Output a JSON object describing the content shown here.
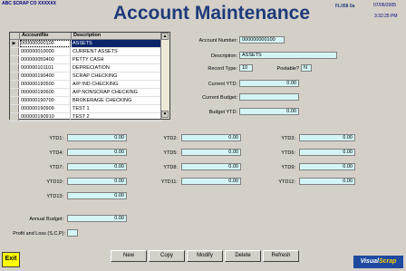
{
  "header": {
    "company": "ABC SCRAP CO XXXXXX",
    "title": "Account Maintenance",
    "form_code": "FL058 0a",
    "date": "07/06/2005",
    "time": "3:32:25 PM"
  },
  "grid": {
    "columns": [
      "AccountNo",
      "Description"
    ],
    "rows": [
      {
        "account": "000000000100",
        "description": "ASSETS"
      },
      {
        "account": "000000010000",
        "description": "CURRENT ASSETS"
      },
      {
        "account": "000000050400",
        "description": "PETTY CASH"
      },
      {
        "account": "000000101101",
        "description": "DEPRECIATION"
      },
      {
        "account": "000000190400",
        "description": "SCRAP CHECKING"
      },
      {
        "account": "000000190500",
        "description": "A/P IND CHECKING"
      },
      {
        "account": "000000190600",
        "description": "A/P NONSCRAP CHECKING"
      },
      {
        "account": "000000190700",
        "description": "BROKERAGE CHECKING"
      },
      {
        "account": "000000190909",
        "description": "TEST 1"
      },
      {
        "account": "000000190910",
        "description": "TEST 2"
      }
    ],
    "selected_marker": "▶"
  },
  "detail": {
    "account_number_label": "Account Number:",
    "account_number": "000000000100",
    "description_label": "Description:",
    "description": "ASSETS",
    "record_type_label": "Record Type:",
    "record_type": "10",
    "postable_label": "Postable?",
    "postable": "N",
    "current_ytd_label": "Current YTD:",
    "current_ytd": "0.00",
    "current_budget_label": "Current Budget:",
    "current_budget": "",
    "budget_ytd_label": "Budget YTD:",
    "budget_ytd": "0.00"
  },
  "ytd": [
    {
      "label": "YTD1:",
      "value": "0.00"
    },
    {
      "label": "YTD2:",
      "value": "0.00"
    },
    {
      "label": "YTD3:",
      "value": "0.00"
    },
    {
      "label": "YTD4:",
      "value": "0.00"
    },
    {
      "label": "YTD5:",
      "value": "0.00"
    },
    {
      "label": "YTD6:",
      "value": "0.00"
    },
    {
      "label": "YTD7:",
      "value": "0.00"
    },
    {
      "label": "YTD8:",
      "value": "0.00"
    },
    {
      "label": "YTD9:",
      "value": "0.00"
    },
    {
      "label": "YTD10:",
      "value": "0.00"
    },
    {
      "label": "YTD11:",
      "value": "0.00"
    },
    {
      "label": "YTD12:",
      "value": "0.00"
    },
    {
      "label": "YTD13:",
      "value": "0.00"
    }
  ],
  "annual_budget_label": "Annual Budget:",
  "annual_budget": "0.00",
  "profit_loss_label": "Profit and Loss (S,C,P):",
  "profit_loss": "",
  "buttons": {
    "exit": "Exit",
    "new": "New",
    "copy": "Copy",
    "modify": "Modify",
    "delete": "Delete",
    "refresh": "Refresh"
  },
  "logo": {
    "part1": "Visual",
    "part2": "Scrap"
  }
}
